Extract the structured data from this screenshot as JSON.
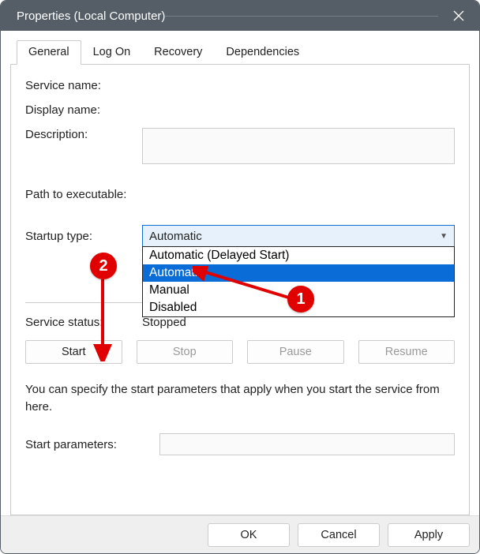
{
  "window": {
    "title": "Properties (Local Computer)"
  },
  "tabs": [
    "General",
    "Log On",
    "Recovery",
    "Dependencies"
  ],
  "active_tab": 0,
  "labels": {
    "service_name": "Service name:",
    "display_name": "Display name:",
    "description": "Description:",
    "path": "Path to executable:",
    "startup_type": "Startup type:",
    "service_status": "Service status:",
    "start_parameters": "Start parameters:"
  },
  "startup": {
    "selected": "Automatic",
    "options": [
      "Automatic (Delayed Start)",
      "Automatic",
      "Manual",
      "Disabled"
    ],
    "highlighted_index": 1
  },
  "status_value": "Stopped",
  "buttons": {
    "start": "Start",
    "stop": "Stop",
    "pause": "Pause",
    "resume": "Resume"
  },
  "hint": "You can specify the start parameters that apply when you start the service from here.",
  "footer": {
    "ok": "OK",
    "cancel": "Cancel",
    "apply": "Apply"
  },
  "annotations": {
    "badge1": "1",
    "badge2": "2"
  }
}
